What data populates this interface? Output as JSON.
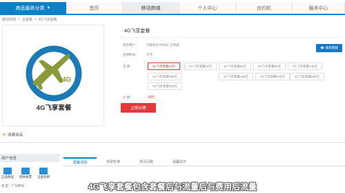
{
  "nav": {
    "category_label": "商品服务分类",
    "items": [
      "首页",
      "移动商城",
      "个人中心",
      "合约机",
      "服务中心"
    ]
  },
  "breadcrumb": [
    "移动商城",
    ">",
    "合套餐",
    ">",
    "4G飞享套餐"
  ],
  "product": {
    "image_caption": "4G飞享套餐",
    "logo_badge": "4G",
    "favorite_label": "收藏商品"
  },
  "details": {
    "title": "4G飞享套餐",
    "rows": [
      {
        "label": "适合用户：",
        "value": "流量很多  时间长   全球通"
      },
      {
        "label": "生效时间：",
        "value": "次月"
      }
    ],
    "package_label": "选   套：",
    "packages": [
      "4G飞享套餐18元",
      "4G飞享套餐38元",
      "4G飞享套餐58元",
      "4G飞享套餐88元",
      "4G飞享套餐138元",
      "4G飞享套餐158元",
      "4G飞享套餐238元",
      "4G飞享套餐288元",
      "4G飞享套餐388元",
      "4G飞享套餐588元"
    ],
    "price_label": "价    格：",
    "price_value": "18元",
    "buy_button": "立即办理",
    "service_button": "联系客服"
  },
  "bottom": {
    "left_title": "商户信息",
    "icons": [
      "正品保证",
      "提供发票",
      "全国包邮"
    ],
    "location": "地    区：广东移动",
    "tabs": [
      "套餐详情",
      "资费标准",
      "常见问题",
      "温馨提示"
    ]
  },
  "subtitle": "4G飞享套餐包含套餐后与流量后与费用后流量",
  "colors": {
    "accent": "#0a80c8",
    "price": "#e33",
    "logo_ring": "#1a7bb8",
    "logo_plane": "#8a9a3a"
  }
}
